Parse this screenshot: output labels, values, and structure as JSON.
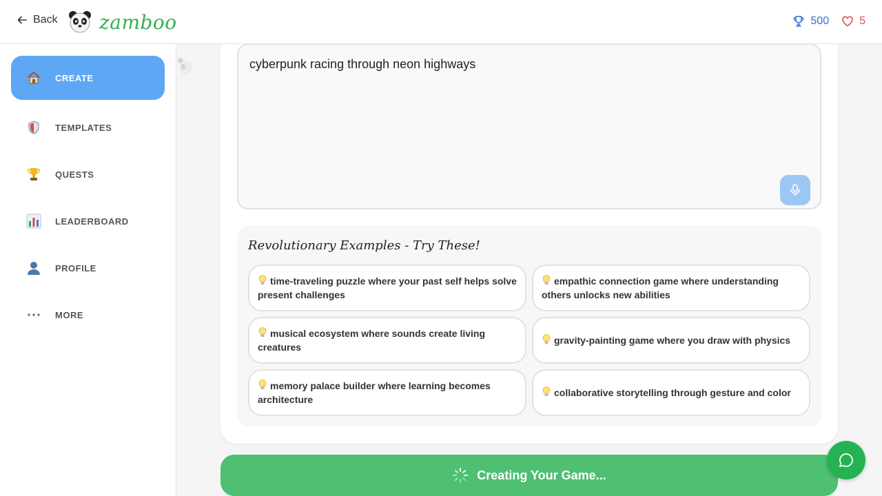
{
  "header": {
    "back_label": "Back",
    "logo_text": "zamboo",
    "trophy_count": "500",
    "hearts_count": "5"
  },
  "sidebar": {
    "items": [
      {
        "label": "CREATE",
        "icon": "house-icon",
        "active": true
      },
      {
        "label": "TEMPLATES",
        "icon": "shield-icon"
      },
      {
        "label": "QUESTS",
        "icon": "trophy-icon"
      },
      {
        "label": "LEADERBOARD",
        "icon": "bar-chart-icon"
      },
      {
        "label": "PROFILE",
        "icon": "user-icon"
      },
      {
        "label": "MORE",
        "icon": "more-dots-icon"
      }
    ]
  },
  "prompt": {
    "value": "cyberpunk racing through neon highways"
  },
  "examples": {
    "title": "Revolutionary Examples - Try These!",
    "items": [
      "time-traveling puzzle where your past self helps solve present challenges",
      "empathic connection game where understanding others unlocks new abilities",
      "musical ecosystem where sounds create living creatures",
      "gravity-painting game where you draw with physics",
      "memory palace builder where learning becomes architecture",
      "collaborative storytelling through gesture and color"
    ]
  },
  "create_button": {
    "label": "Creating Your Game..."
  },
  "colors": {
    "accent_blue": "#5ea7f5",
    "brand_green": "#2fb34f",
    "button_green": "#4fbf72",
    "fab_green": "#24b353",
    "trophy_blue": "#2b6fd8",
    "heart_red": "#e54848"
  }
}
